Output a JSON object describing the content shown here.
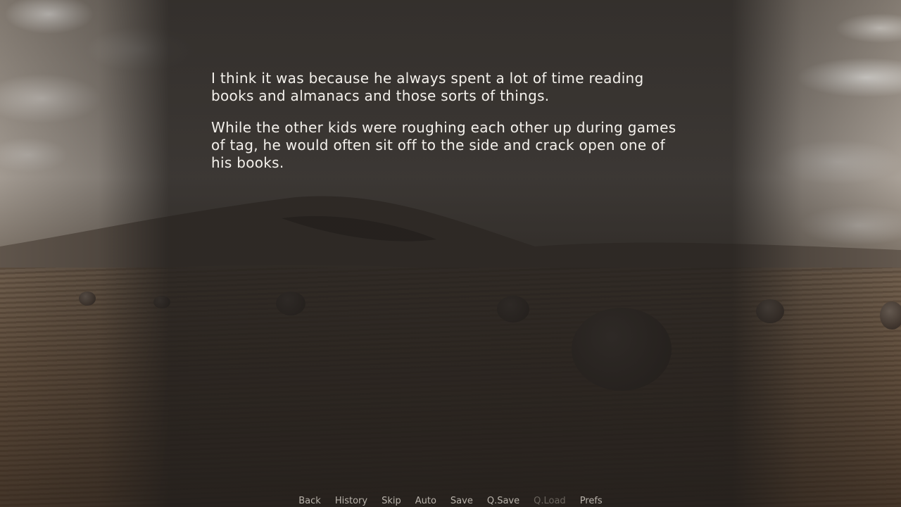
{
  "dialogue": {
    "paragraphs": [
      "I think it was because he always spent a lot of time reading books and almanacs and those sorts of things.",
      "While the other kids were roughing each other up during games of tag, he would often sit off to the side and crack open one of his books."
    ]
  },
  "quick_menu": {
    "back": "Back",
    "history": "History",
    "skip": "Skip",
    "auto": "Auto",
    "save": "Save",
    "qsave": "Q.Save",
    "qload": "Q.Load",
    "prefs": "Prefs"
  },
  "colors": {
    "dialogue_text": "#f4f1ec",
    "menu_text": "#b9b3ab",
    "menu_text_disabled": "#6a645d"
  }
}
